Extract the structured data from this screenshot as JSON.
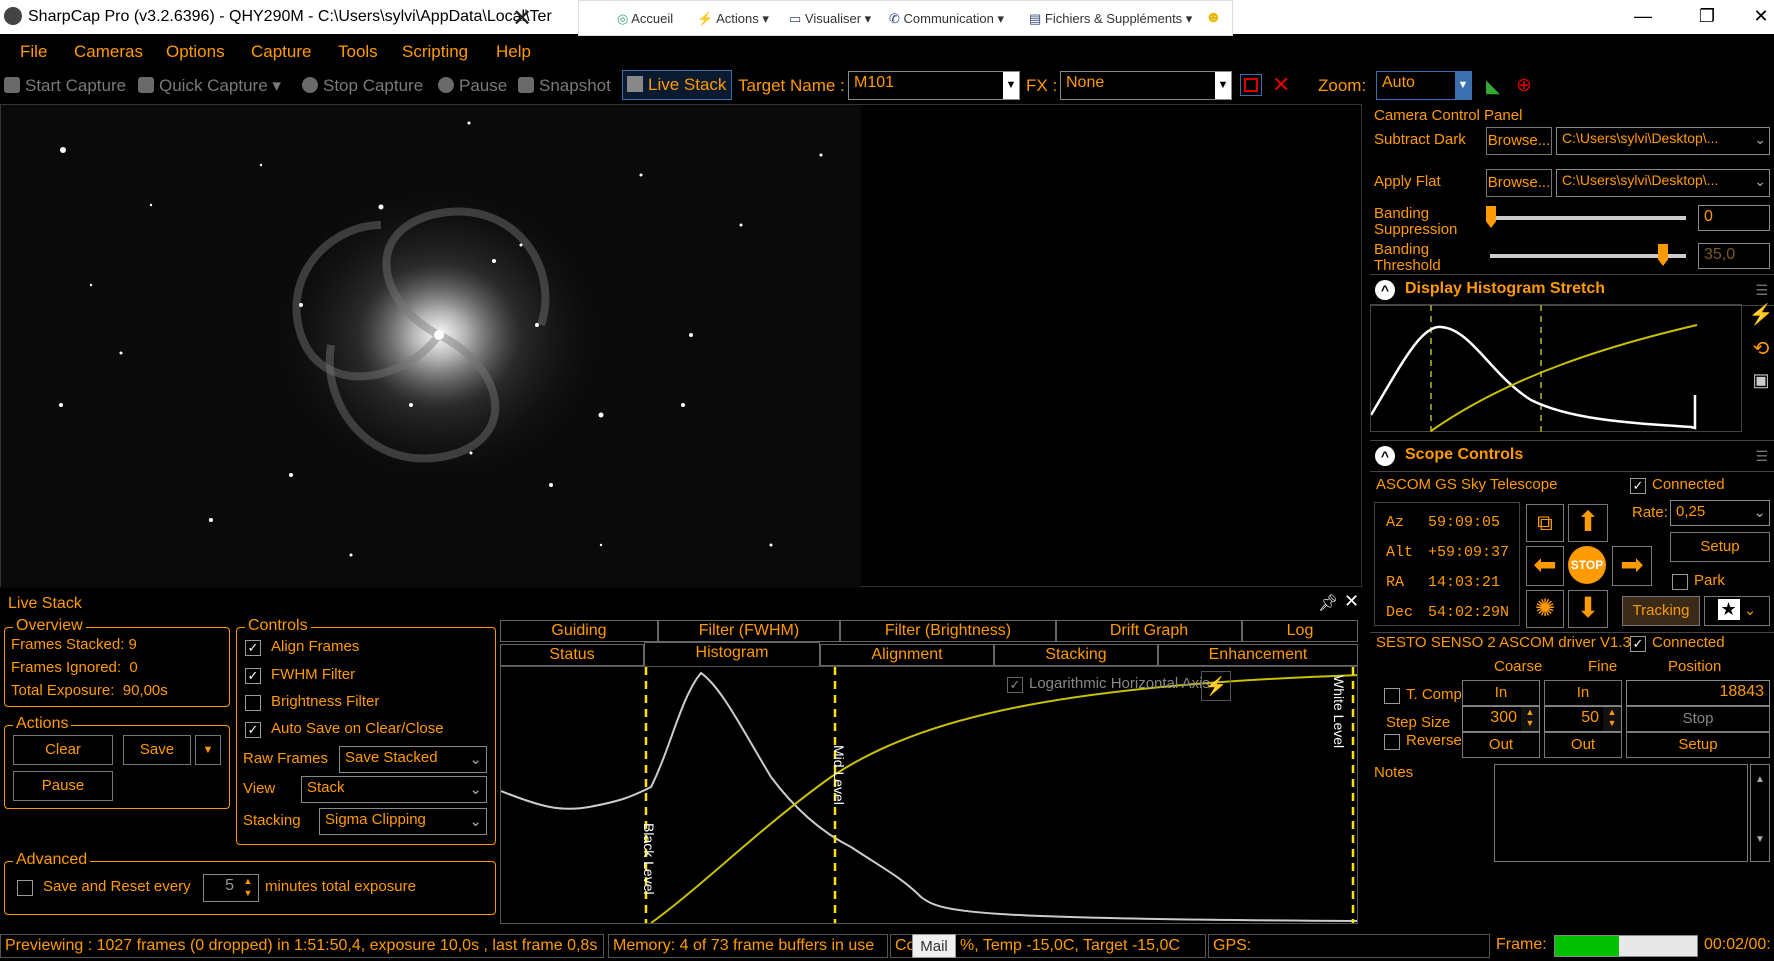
{
  "window": {
    "title": "SharpCap Pro (v3.2.6396) - QHY290M - C:\\Users\\sylvi\\AppData\\Local\\Ter",
    "remote_toolbar": [
      "Accueil",
      "Actions",
      "Visualiser",
      "Communication",
      "Fichiers & Suppléments"
    ]
  },
  "menu": [
    "File",
    "Cameras",
    "Options",
    "Capture",
    "Tools",
    "Scripting",
    "Help"
  ],
  "toolbar": {
    "start_capture": "Start Capture",
    "quick_capture": "Quick Capture",
    "stop_capture": "Stop Capture",
    "pause": "Pause",
    "snapshot": "Snapshot",
    "live_stack": "Live Stack",
    "target_name_label": "Target Name :",
    "target_name_value": "M101",
    "fx_label": "FX :",
    "fx_value": "None",
    "zoom_label": "Zoom:",
    "zoom_value": "Auto"
  },
  "camera_control": {
    "title": "Camera Control Panel",
    "subtract_dark": "Subtract Dark",
    "apply_flat": "Apply Flat",
    "browse": "Browse...",
    "dark_path": "C:\\Users\\sylvi\\Desktop\\...",
    "flat_path": "C:\\Users\\sylvi\\Desktop\\...",
    "banding_suppression_l1": "Banding",
    "banding_suppression_l2": "Suppression",
    "banding_suppression_value": "0",
    "banding_threshold_l1": "Banding",
    "banding_threshold_l2": "Threshold",
    "banding_threshold_value": "35,0"
  },
  "histogram_stretch": {
    "title": "Display Histogram Stretch"
  },
  "scope": {
    "title": "Scope Controls",
    "telescope": "ASCOM GS Sky Telescope",
    "connected": "Connected",
    "az_label": "Az",
    "az": "59:09:05",
    "alt_label": "Alt",
    "alt": "+59:09:37",
    "ra_label": "RA",
    "ra": "14:03:21",
    "dec_label": "Dec",
    "dec": "54:02:29N",
    "rate_label": "Rate:",
    "rate": "0,25",
    "setup": "Setup",
    "park": "Park",
    "stop": "STOP",
    "tracking": "Tracking"
  },
  "focuser": {
    "name": "SESTO SENSO 2 ASCOM driver V1.3",
    "connected": "Connected",
    "coarse": "Coarse",
    "fine": "Fine",
    "position": "Position",
    "t_comp": "T. Comp",
    "in": "In",
    "out": "Out",
    "position_value": "18843",
    "step_size": "Step Size",
    "coarse_step": "300",
    "fine_step": "50",
    "stop": "Stop",
    "setup": "Setup",
    "reverse": "Reverse"
  },
  "notes": {
    "label": "Notes"
  },
  "live_stack": {
    "title": "Live Stack",
    "overview": {
      "title": "Overview",
      "frames_stacked": "Frames Stacked: 9",
      "frames_ignored": "Frames Ignored:  0",
      "total_exposure": "Total Exposure:  90,00s"
    },
    "actions": {
      "title": "Actions",
      "clear": "Clear",
      "save": "Save",
      "pause": "Pause"
    },
    "controls": {
      "title": "Controls",
      "align_frames": "Align Frames",
      "fwhm_filter": "FWHM Filter",
      "brightness_filter": "Brightness Filter",
      "auto_save": "Auto Save on Clear/Close",
      "raw_frames_label": "Raw Frames",
      "raw_frames_value": "Save Stacked",
      "view_label": "View",
      "view_value": "Stack",
      "stacking_label": "Stacking",
      "stacking_value": "Sigma Clipping"
    },
    "advanced": {
      "title": "Advanced",
      "save_reset": "Save and Reset every",
      "minutes_value": "5",
      "minutes_label": "minutes total exposure"
    },
    "tabs_row1": [
      "Guiding",
      "Filter (FWHM)",
      "Filter (Brightness)",
      "Drift Graph",
      "Log"
    ],
    "tabs_row2": [
      "Status",
      "Histogram",
      "Alignment",
      "Stacking",
      "Enhancement"
    ],
    "histogram": {
      "log_axis": "Logarithmic Horizontal Axis",
      "black_level": "Black Level",
      "mid_level": "Mid Level",
      "white_level": "White Level"
    }
  },
  "status": {
    "previewing": "Previewing : 1027 frames (0 dropped) in 1:51:50,4, exposure 10,0s , last frame 0,8s",
    "memory": "Memory: 4 of 73 frame buffers in use",
    "co": "Co",
    "mail_tooltip": "Mail",
    "temp": "%, Temp -15,0C, Target -15,0C",
    "gps": "GPS:",
    "frame_label": "Frame:",
    "frame_progress": 0.45,
    "elapsed": "00:02/00:"
  },
  "colors": {
    "accent": "#ff9a00",
    "curve": "#c8c000",
    "progress": "#00c000"
  }
}
